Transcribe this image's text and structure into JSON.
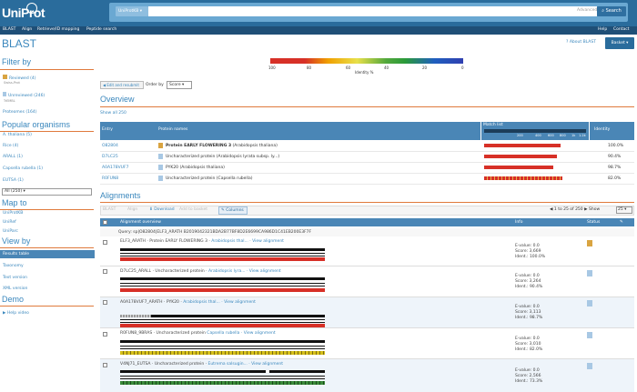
{
  "header": {
    "logo": "UniProt",
    "logo_tagline": "",
    "db_select": "UniProtKB ▾",
    "query_value": "",
    "advanced_label": "Advanced ▾",
    "search_label": "Search"
  },
  "nav": {
    "items": [
      "BLAST",
      "Align",
      "Retrieve/ID mapping",
      "Peptide search",
      "Help",
      "Contact"
    ]
  },
  "page": {
    "title": "BLAST",
    "about_label": "About BLAST",
    "basket_label": "Basket ▾"
  },
  "sidebar": {
    "filter_by": "Filter by",
    "reviewed": "Reviewed (4)",
    "reviewed_sub": "Swiss-Prot",
    "unreviewed": "Unreviewed (246)",
    "unreviewed_sub": "TrEMBL",
    "proteomes": "Proteomes (164)",
    "popular_organisms": "Popular organisms",
    "organisms": [
      "A. thaliana (5)",
      "Rice (4)",
      "ARALL (1)",
      "Capsella rubella (1)",
      "EUTSA (1)"
    ],
    "org_select": "All (250) ▾",
    "map_to": "Map to",
    "map_items": [
      "UniProtKB",
      "UniRef",
      "UniParc"
    ],
    "view_by": "View by",
    "view_items": [
      "Results table",
      "Taxonomy",
      "Text version",
      "XML version"
    ],
    "demo": "Demo",
    "help_video": "Help video"
  },
  "legend": {
    "ticks": [
      "100",
      "80",
      "60",
      "40",
      "20",
      "0"
    ],
    "label": "Identity %"
  },
  "controls": {
    "edit_resubmit": "Edit and resubmit",
    "order_by_label": "Order by",
    "order_by_value": "Score ▾"
  },
  "overview": {
    "title": "Overview",
    "show_all": "Show all 250",
    "headers": {
      "entry": "Entry",
      "protein_names": "Protein names",
      "match_list": "Match list",
      "identity": "Identity"
    },
    "scale_ticks": [
      "200",
      "400",
      "600",
      "800",
      "1k",
      "1.2k"
    ],
    "rows": [
      {
        "entry": "O82804",
        "name": "Protein EARLY FLOWERING 3",
        "organism": "(Arabidopsis thaliana)",
        "identity": "100.0%",
        "identity_value": 100
      },
      {
        "entry": "D7LC25",
        "name": "Uncharacterized protein",
        "organism": "(Arabidopsis lyrata subsp. ly...)",
        "identity": "90.4%",
        "identity_value": 90.4
      },
      {
        "entry": "A0A178VUF7",
        "name": "PYK20",
        "organism": "(Arabidopsis thaliana)",
        "identity": "98.7%",
        "identity_value": 98.7
      },
      {
        "entry": "R0FUN8",
        "name": "Uncharacterized protein",
        "organism": "(Capsella rubella)",
        "identity": "82.0%",
        "identity_value": 82.0
      }
    ]
  },
  "alignments": {
    "title": "Alignments",
    "toolbar": {
      "blast": "BLAST",
      "align": "Align",
      "download": "Download",
      "add_to_basket": "Add to basket",
      "columns": "Columns"
    },
    "pager": "1 to 25 of 250",
    "show_label": "Show",
    "show_value": "25 ▾",
    "headers": {
      "overview": "Alignment overview",
      "info": "Info",
      "status": "Status"
    },
    "query": "Query: sp|O82804|ELF3_ARATH B2019042321BDA2B77BF8D2E6699CA986D1C41EB200E3F7F",
    "rows": [
      {
        "id": "ELF3_ARATH",
        "desc": "· Protein EARLY FLOWERING 3 ·",
        "organism": "Arabidopsis thal...",
        "view": "· View alignment",
        "evalue": "E-value: 0.0",
        "score": "Score: 3,669",
        "ident": "Ident.: 100.0%"
      },
      {
        "id": "D7LC25_ARALL",
        "desc": "· Uncharacterized protein ·",
        "organism": "Arabidopsis lyra...",
        "view": "· View alignment",
        "evalue": "E-value: 0.0",
        "score": "Score: 3,264",
        "ident": "Ident.: 90.4%"
      },
      {
        "id": "A0A178VUF7_ARATH",
        "desc": "· PYK20 ·",
        "organism": "Arabidopsis thal...",
        "view": "· View alignment",
        "evalue": "E-value: 0.0",
        "score": "Score: 3,113",
        "ident": "Ident.: 98.7%"
      },
      {
        "id": "R0FUN8_9BRAS",
        "desc": "· Uncharacterized protein",
        "organism": "Capsella rubella",
        "view": "· View alignment",
        "evalue": "E-value: 0.0",
        "score": "Score: 3,010",
        "ident": "Ident.: 82.0%"
      },
      {
        "id": "V4NJ71_EUTSA",
        "desc": "· Uncharacterized protein ·",
        "organism": "Eutrema salsugin...",
        "view": "· View alignment",
        "evalue": "E-value: 0.0",
        "score": "Score: 2,566",
        "ident": "Ident.: 73.3%"
      }
    ]
  },
  "colors": {
    "header": "#2a6c9c",
    "accent": "#3a87bd",
    "divider": "#e07a3c",
    "high_identity": "#d73027"
  }
}
